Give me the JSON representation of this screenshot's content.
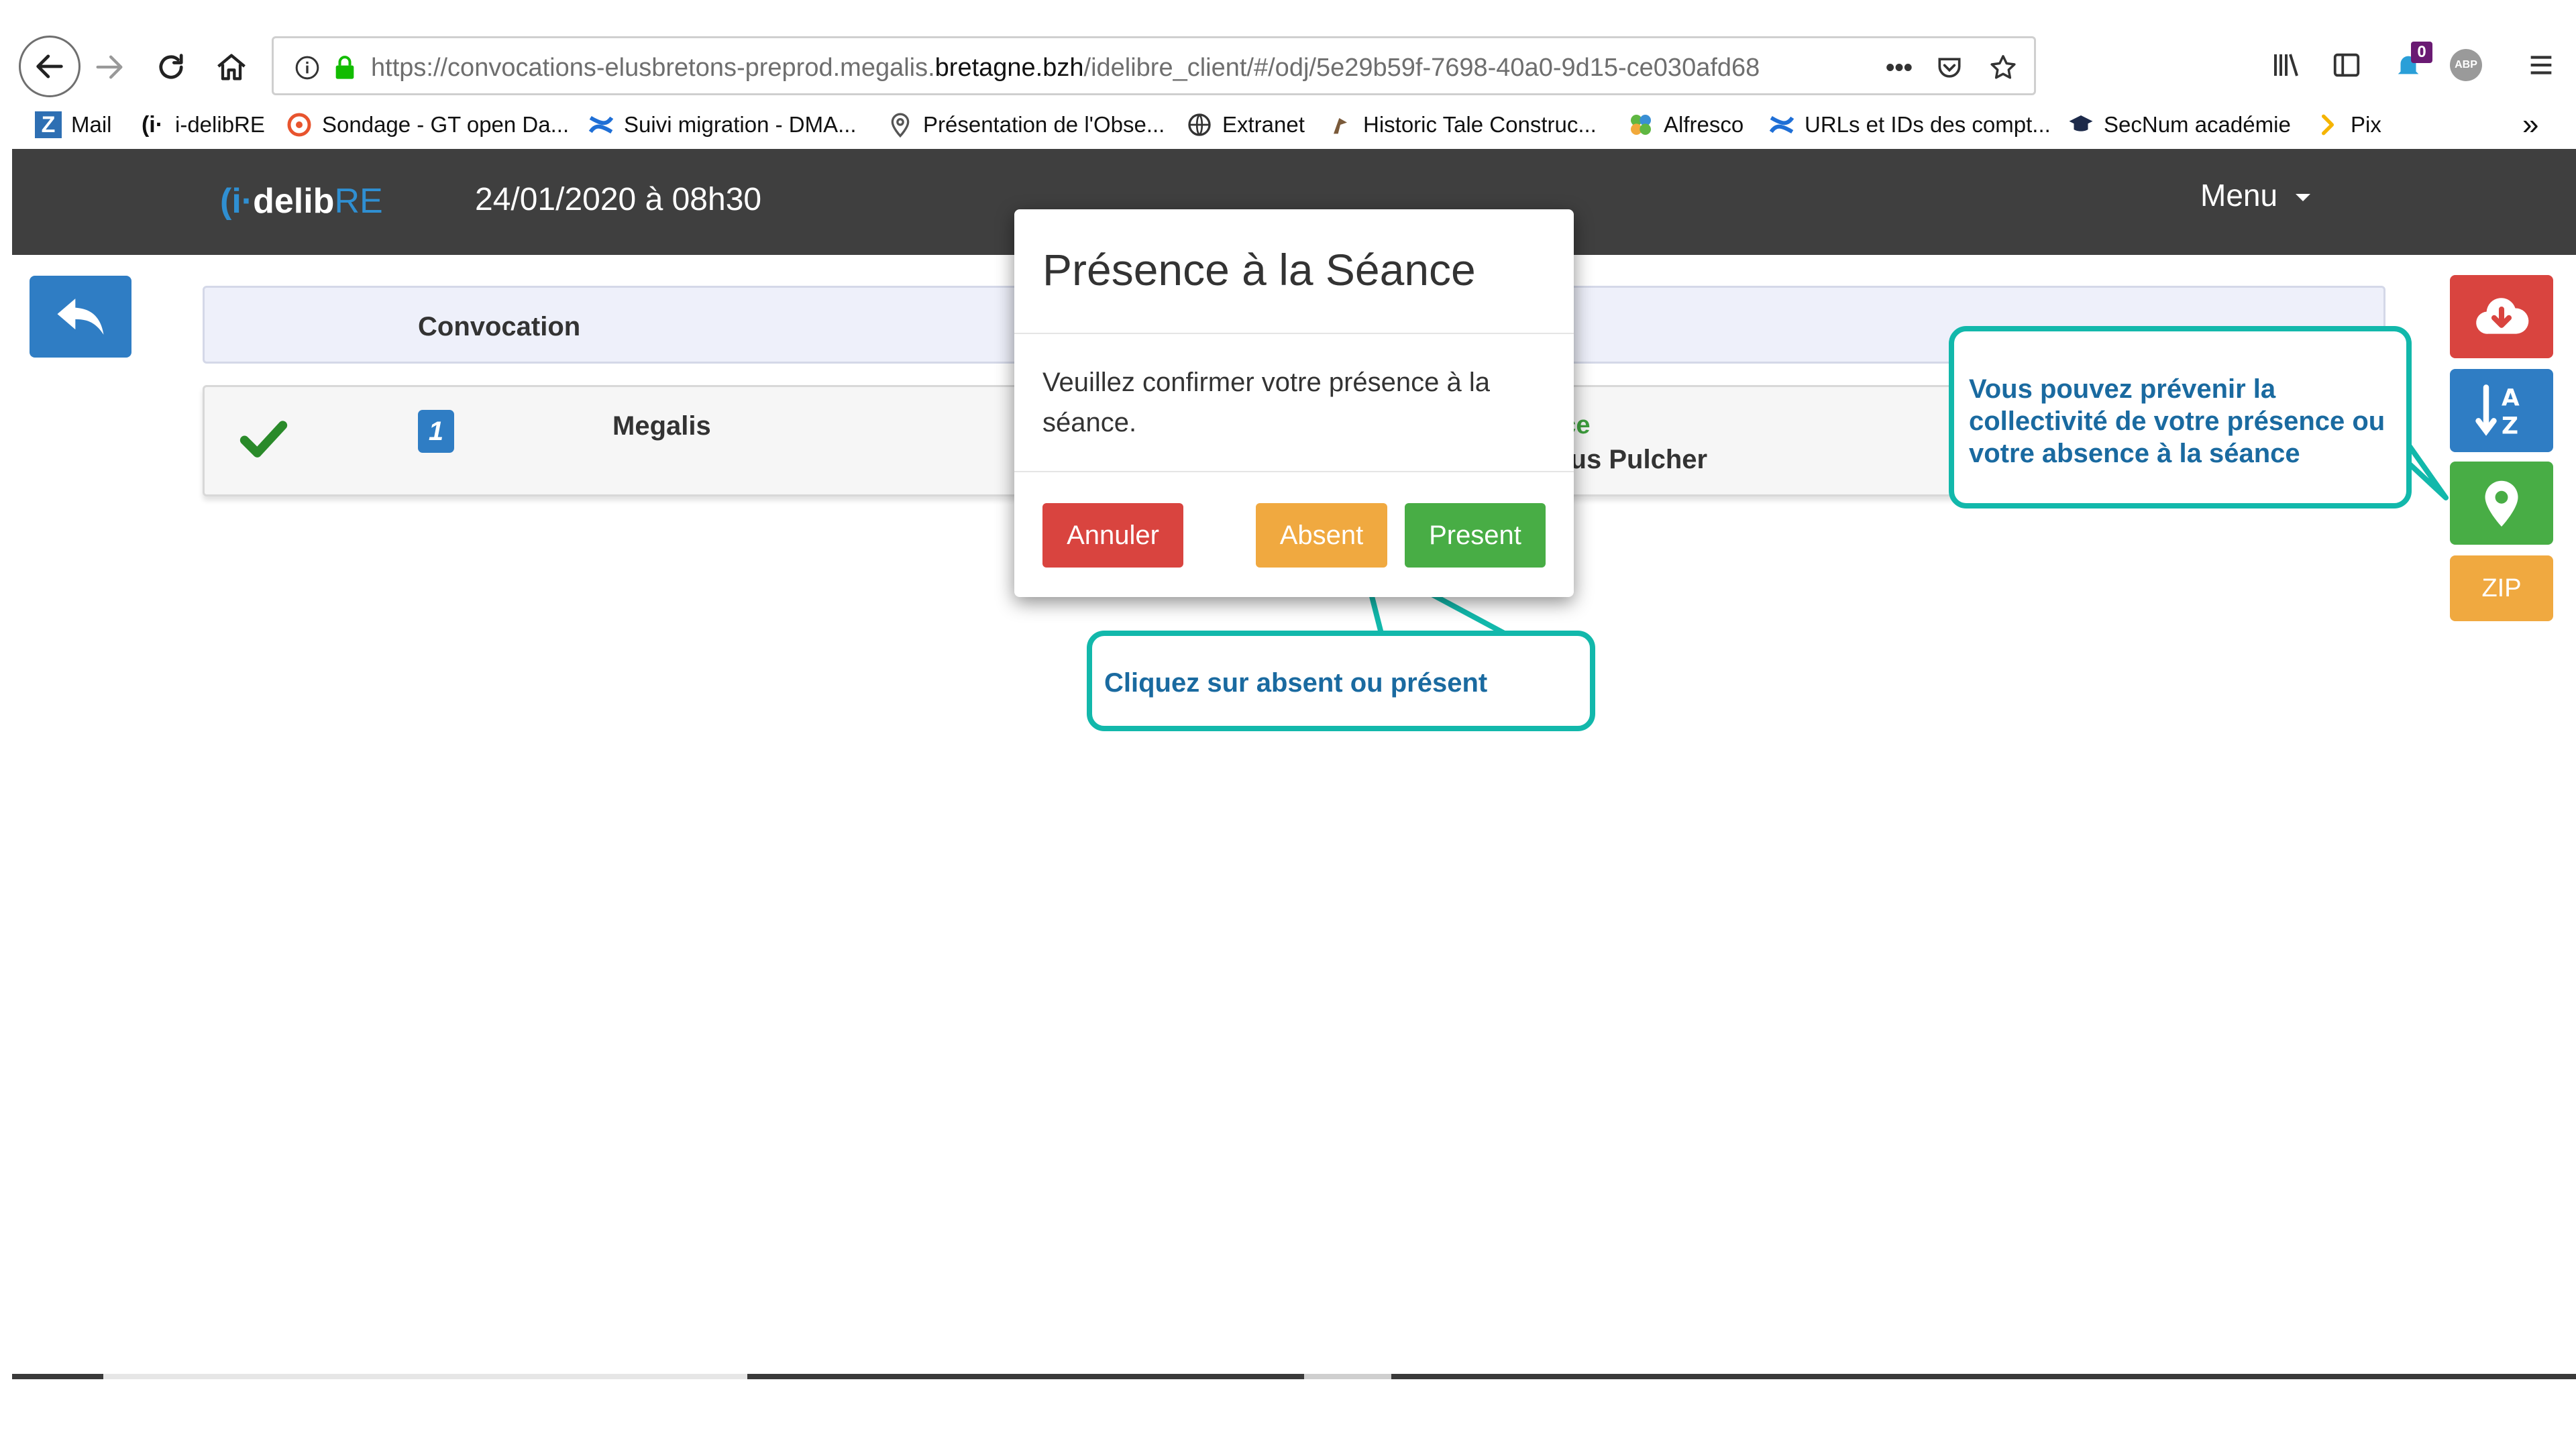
{
  "browser": {
    "url_prefix": "https://convocations-elusbretons-preprod.megalis.",
    "url_domain": "bretagne.bzh",
    "url_suffix": "/idelibre_client/#/odj/5e29b59f-7698-40a0-9d15-ce030afd68",
    "more_label": "•••",
    "notification_count": "0",
    "abp_label": "ABP",
    "overflow_label": "»",
    "bookmarks": [
      {
        "label": "Mail",
        "icon": "zimbra-icon"
      },
      {
        "label": "i-delibRE",
        "icon": "idelibre-icon"
      },
      {
        "label": "Sondage - GT open Da...",
        "icon": "poll-icon"
      },
      {
        "label": "Suivi migration - DMA...",
        "icon": "confluence-icon"
      },
      {
        "label": "Présentation de l'Obse...",
        "icon": "map-pin-icon"
      },
      {
        "label": "Extranet",
        "icon": "globe-icon"
      },
      {
        "label": "Historic Tale Construc...",
        "icon": "game-icon"
      },
      {
        "label": "Alfresco",
        "icon": "alfresco-icon"
      },
      {
        "label": "URLs et IDs des compt...",
        "icon": "confluence-icon"
      },
      {
        "label": "SecNum académie",
        "icon": "graduation-cap-icon"
      },
      {
        "label": "Pix",
        "icon": "pix-icon"
      }
    ]
  },
  "app": {
    "logo_prefix": "(i·",
    "logo_main": "delib",
    "logo_suffix": "RE",
    "date": "24/01/2020 à 08h30",
    "menu_label": "Menu"
  },
  "table": {
    "header_label": "Convocation",
    "row": {
      "number": "1",
      "name": "Megalis",
      "status_partial": "nce",
      "person_partial": "dius Pulcher"
    }
  },
  "side_buttons": {
    "zip_label": "ZIP"
  },
  "modal": {
    "title": "Présence à la Séance",
    "body": "Veuillez confirmer votre présence à la séance.",
    "cancel_label": "Annuler",
    "absent_label": "Absent",
    "present_label": "Present"
  },
  "callouts": {
    "modal_hint": "Cliquez sur absent ou présent",
    "side_hint": "Vous pouvez prévenir la collectivité de votre présence ou votre absence à la séance"
  },
  "colors": {
    "navbar": "#3f3f3f",
    "primary": "#2f7dc4",
    "danger": "#d9443f",
    "warning": "#f0a940",
    "success": "#48ad45",
    "callout_border": "#12b8ab",
    "callout_text": "#1a6aa0"
  }
}
